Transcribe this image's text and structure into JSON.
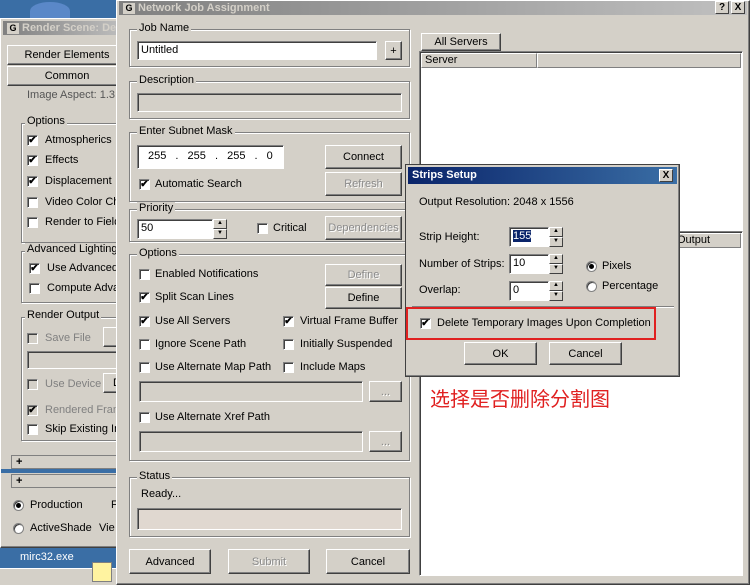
{
  "desktop": {
    "taskbar_item": "mirc32.exe"
  },
  "render_scene": {
    "title": "Render Scene: De",
    "tabs": [
      "Render Elements",
      "Common"
    ],
    "cutoff_text": "Image Aspect: 1.3",
    "options_label": "Options",
    "options": [
      {
        "label": "Atmospherics",
        "checked": true
      },
      {
        "label": "Effects",
        "checked": true
      },
      {
        "label": "Displacement",
        "checked": true
      },
      {
        "label": "Video Color Che",
        "checked": false
      },
      {
        "label": "Render to Field",
        "checked": false
      }
    ],
    "advanced_lighting_label": "Advanced Lighting",
    "advanced_lighting": [
      {
        "label": "Use Advanced",
        "checked": true
      },
      {
        "label": "Compute Adva",
        "checked": false
      }
    ],
    "render_output_label": "Render Output",
    "save_file": "Save File",
    "use_device": "Use Device",
    "d_button": "D",
    "rendered_frame": "Rendered Fram",
    "skip_existing": "Skip Existing Im",
    "plus": "+",
    "production": "Production",
    "activeshade": "ActiveShade",
    "f_label": "F",
    "view_label": "Vie"
  },
  "network_job": {
    "title": "Network Job Assignment",
    "title_buttons": [
      "?",
      "X"
    ],
    "job_name_label": "Job Name",
    "job_name_value": "Untitled",
    "plus_button": "+",
    "description_label": "Description",
    "subnet_label": "Enter Subnet Mask",
    "subnet_octets": [
      "255",
      "255",
      "255",
      "0"
    ],
    "dot": ".",
    "connect_button": "Connect",
    "refresh_button": "Refresh",
    "automatic_search": "Automatic Search",
    "priority_label": "Priority",
    "priority_value": "50",
    "critical": "Critical",
    "dependencies_button": "Dependencies",
    "options_label": "Options",
    "enabled_notifications": "Enabled Notifications",
    "define_button": "Define",
    "split_scan_lines": "Split Scan Lines",
    "use_all_servers": "Use All Servers",
    "virtual_frame_buffer": "Virtual Frame Buffer",
    "ignore_scene_path": "Ignore Scene Path",
    "initially_suspended": "Initially Suspended",
    "use_alternate_map_path": "Use Alternate Map Path",
    "include_maps": "Include Maps",
    "browse_button": "...",
    "use_alternate_xref_path": "Use Alternate Xref Path",
    "status_label": "Status",
    "status_text": "Ready...",
    "advanced_button": "Advanced",
    "submit_button": "Submit",
    "cancel_button": "Cancel",
    "servers_tab": "All Servers",
    "server_column": "Server",
    "output_column": "Output"
  },
  "strips_setup": {
    "title": "Strips Setup",
    "close": "X",
    "output_resolution": "Output Resolution: 2048 x 1556",
    "strip_height_label": "Strip Height:",
    "strip_height_value": "155",
    "num_strips_label": "Number of Strips:",
    "num_strips_value": "10",
    "overlap_label": "Overlap:",
    "overlap_value": "0",
    "pixels": "Pixels",
    "percentage": "Percentage",
    "delete_temp": "Delete Temporary Images Upon Completion",
    "ok_button": "OK",
    "cancel_button": "Cancel",
    "highlight_color": "#e02020"
  },
  "annotation": {
    "text": "选择是否删除分割图",
    "color": "#e02020"
  }
}
